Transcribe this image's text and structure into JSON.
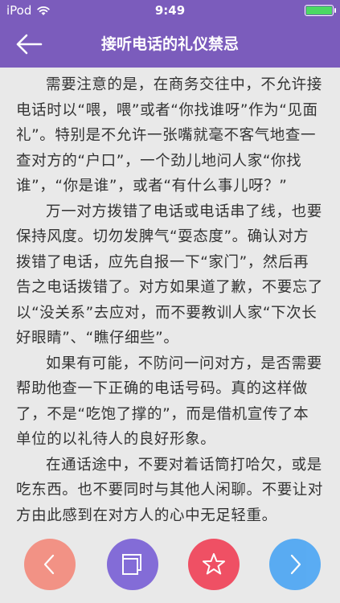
{
  "status_bar": {
    "carrier": "iPod",
    "time": "9:49",
    "battery_level": 1.0,
    "battery_color": "#4cd964"
  },
  "header": {
    "title": "接听电话的礼仪禁忌",
    "back_icon": "arrow-left-icon",
    "background": "#7b5cbc"
  },
  "article": {
    "paragraphs": [
      "需要注意的是，在商务交往中，不允许接电话时以“喂，喂”或者“你找谁呀”作为“见面礼”。特别是不允许一张嘴就毫不客气地查一查对方的“户口”，一个劲儿地问人家“你找谁”，“你是谁”，或者“有什么事儿呀？”",
      "万一对方拨错了电话或电话串了线，也要保持风度。切勿发脾气“耍态度”。确认对方拨错了电话，应先自报一下“家门”，然后再告之电话拨错了。对方如果道了歉，不要忘了以“没关系”去应对，而不要教训人家“下次长好眼睛”、“瞧仔细些”。",
      "如果有可能，不防问一问对方，是否需要帮助他查一下正确的电话号码。真的这样做了，不是“吃饱了撑的”，而是借机宣传了本单位的以礼待人的良好形象。",
      "在通话途中，不要对着话筒打哈欠，或是吃东西。也不要同时与其他人闲聊。不要让对方由此感到在对方人的心中无足轻重。"
    ]
  },
  "bottom_actions": [
    {
      "name": "previous",
      "icon": "chevron-left-icon",
      "color": "#f38c7e"
    },
    {
      "name": "catalog",
      "icon": "stacked-pages-icon",
      "color": "#7c63d6"
    },
    {
      "name": "favorite",
      "icon": "star-icon",
      "color": "#f0455a"
    },
    {
      "name": "next",
      "icon": "chevron-right-icon",
      "color": "#4fa7f3"
    }
  ]
}
